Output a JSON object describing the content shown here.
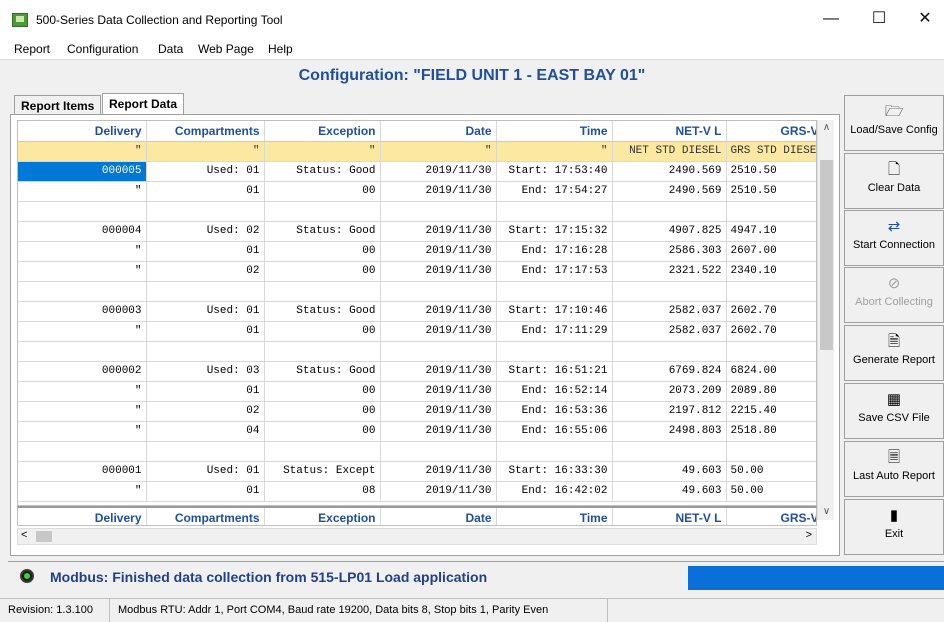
{
  "window": {
    "title": "500-Series Data Collection and Reporting Tool",
    "minimize": "—",
    "maximize": "☐",
    "close": "✕"
  },
  "menu": [
    "Report",
    "Configuration",
    "Data",
    "Web Page",
    "Help"
  ],
  "config_title": "Configuration: \"FIELD UNIT 1 - EAST BAY 01\"",
  "tabs": [
    {
      "label": "Report Items",
      "active": false
    },
    {
      "label": "Report Data",
      "active": true
    }
  ],
  "table": {
    "headers": [
      "Delivery",
      "Compartments",
      "Exception",
      "Date",
      "Time",
      "NET-V  L",
      "GRS-V  L"
    ],
    "subheader": [
      "\"",
      "\"",
      "\"",
      "\"",
      "\"",
      "NET STD DIESEL",
      "GRS STD DIESEI"
    ],
    "rows": [
      [
        "000005",
        "Used: 01",
        "Status: Good",
        "2019/11/30",
        "Start: 17:53:40",
        "2490.569",
        "2510.50"
      ],
      [
        "\"",
        "01",
        "00",
        "2019/11/30",
        "End: 17:54:27",
        "2490.569",
        "2510.50"
      ],
      [
        "",
        "",
        "",
        "",
        "",
        "",
        ""
      ],
      [
        "000004",
        "Used: 02",
        "Status: Good",
        "2019/11/30",
        "Start: 17:15:32",
        "4907.825",
        "4947.10"
      ],
      [
        "\"",
        "01",
        "00",
        "2019/11/30",
        "End: 17:16:28",
        "2586.303",
        "2607.00"
      ],
      [
        "\"",
        "02",
        "00",
        "2019/11/30",
        "End: 17:17:53",
        "2321.522",
        "2340.10"
      ],
      [
        "",
        "",
        "",
        "",
        "",
        "",
        ""
      ],
      [
        "000003",
        "Used: 01",
        "Status: Good",
        "2019/11/30",
        "Start: 17:10:46",
        "2582.037",
        "2602.70"
      ],
      [
        "\"",
        "01",
        "00",
        "2019/11/30",
        "End: 17:11:29",
        "2582.037",
        "2602.70"
      ],
      [
        "",
        "",
        "",
        "",
        "",
        "",
        ""
      ],
      [
        "000002",
        "Used: 03",
        "Status: Good",
        "2019/11/30",
        "Start: 16:51:21",
        "6769.824",
        "6824.00"
      ],
      [
        "\"",
        "01",
        "00",
        "2019/11/30",
        "End: 16:52:14",
        "2073.209",
        "2089.80"
      ],
      [
        "\"",
        "02",
        "00",
        "2019/11/30",
        "End: 16:53:36",
        "2197.812",
        "2215.40"
      ],
      [
        "\"",
        "04",
        "00",
        "2019/11/30",
        "End: 16:55:06",
        "2498.803",
        "2518.80"
      ],
      [
        "",
        "",
        "",
        "",
        "",
        "",
        ""
      ],
      [
        "000001",
        "Used: 01",
        "Status: Except",
        "2019/11/30",
        "Start: 16:33:30",
        "49.603",
        "50.00"
      ],
      [
        "\"",
        "01",
        "08",
        "2019/11/30",
        "End: 16:42:02",
        "49.603",
        "50.00"
      ]
    ]
  },
  "scroll": {
    "up": "∧",
    "down": "∨",
    "left": "<",
    "right": ">"
  },
  "side_buttons": [
    {
      "label": "Load/Save Config",
      "icon": "folder-disk-icon",
      "glyph": "🗁",
      "enabled": true
    },
    {
      "label": "Clear Data",
      "icon": "clear-data-icon",
      "glyph": "🗋",
      "enabled": true
    },
    {
      "label": "Start Connection",
      "icon": "connection-arrows-icon",
      "glyph": "⇄",
      "enabled": true
    },
    {
      "label": "Abort Collecting",
      "icon": "abort-icon",
      "glyph": "⊘",
      "enabled": false
    },
    {
      "label": "Generate Report",
      "icon": "report-icon",
      "glyph": "🗎",
      "enabled": true
    },
    {
      "label": "Save CSV File",
      "icon": "csv-grid-icon",
      "glyph": "▦",
      "enabled": true
    },
    {
      "label": "Last Auto Report",
      "icon": "auto-report-icon",
      "glyph": "🗏",
      "enabled": true
    },
    {
      "label": "Exit",
      "icon": "exit-door-icon",
      "glyph": "▮",
      "enabled": true
    }
  ],
  "status": {
    "message": "Modbus: Finished data collection from 515-LP01 Load application",
    "led_color": "#3fcf3f",
    "progress": 1.0
  },
  "statusbar": {
    "revision": "Revision: 1.3.100",
    "connection": "Modbus RTU: Addr 1, Port COM4, Baud rate 19200, Data bits 8, Stop bits 1, Parity Even"
  },
  "colors": {
    "accent": "#1f4fa0",
    "selection": "#0078d7",
    "subheader_bg": "#fce8a0",
    "progress": "#0a6fd6"
  }
}
